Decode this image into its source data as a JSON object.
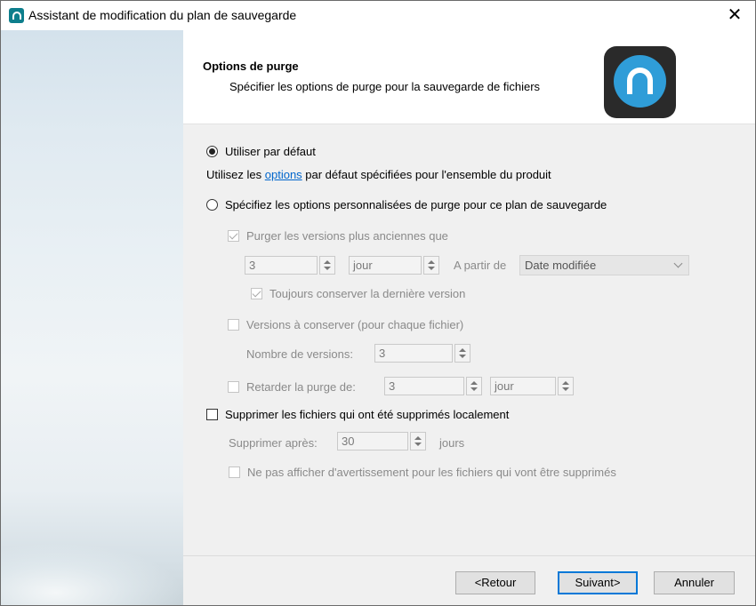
{
  "window": {
    "title": "Assistant de modification du plan de sauvegarde",
    "close_glyph": "✕"
  },
  "header": {
    "title": "Options de purge",
    "description": "Spécifier les options de purge pour la sauvegarde de fichiers"
  },
  "options": {
    "use_default_label": "Utiliser par défaut",
    "default_prefix": "Utilisez les ",
    "default_link": "options",
    "default_suffix": " par défaut spécifiées pour l'ensemble du produit",
    "custom_label": "Spécifiez les options personnalisées de purge pour ce plan de sauvegarde",
    "selected": "default"
  },
  "purge_older": {
    "label": "Purger les versions plus anciennes que",
    "checked": true,
    "value": "3",
    "unit": "jour",
    "from_label": "A partir de",
    "from_value": "Date modifiée",
    "keep_last_label": "Toujours conserver la dernière version",
    "keep_last_checked": true
  },
  "versions": {
    "label": "Versions à conserver (pour chaque fichier)",
    "checked": false,
    "count_label": "Nombre de versions:",
    "count_value": "3"
  },
  "delay": {
    "label": "Retarder la purge de:",
    "checked": false,
    "value": "3",
    "unit": "jour"
  },
  "delete_local": {
    "label": "Supprimer les fichiers qui ont été supprimés localement",
    "checked": false,
    "after_label": "Supprimer après:",
    "after_value": "30",
    "after_unit": "jours",
    "no_warning_label": "Ne pas afficher d'avertissement pour les fichiers qui vont être supprimés",
    "no_warning_checked": false
  },
  "footer": {
    "back": "<Retour",
    "next": "Suivant>",
    "cancel": "Annuler"
  },
  "colors": {
    "accent": "#0078d7",
    "link": "#0066cc",
    "logo_blue": "#2f9dd8",
    "logo_bg": "#2a2a2a"
  }
}
